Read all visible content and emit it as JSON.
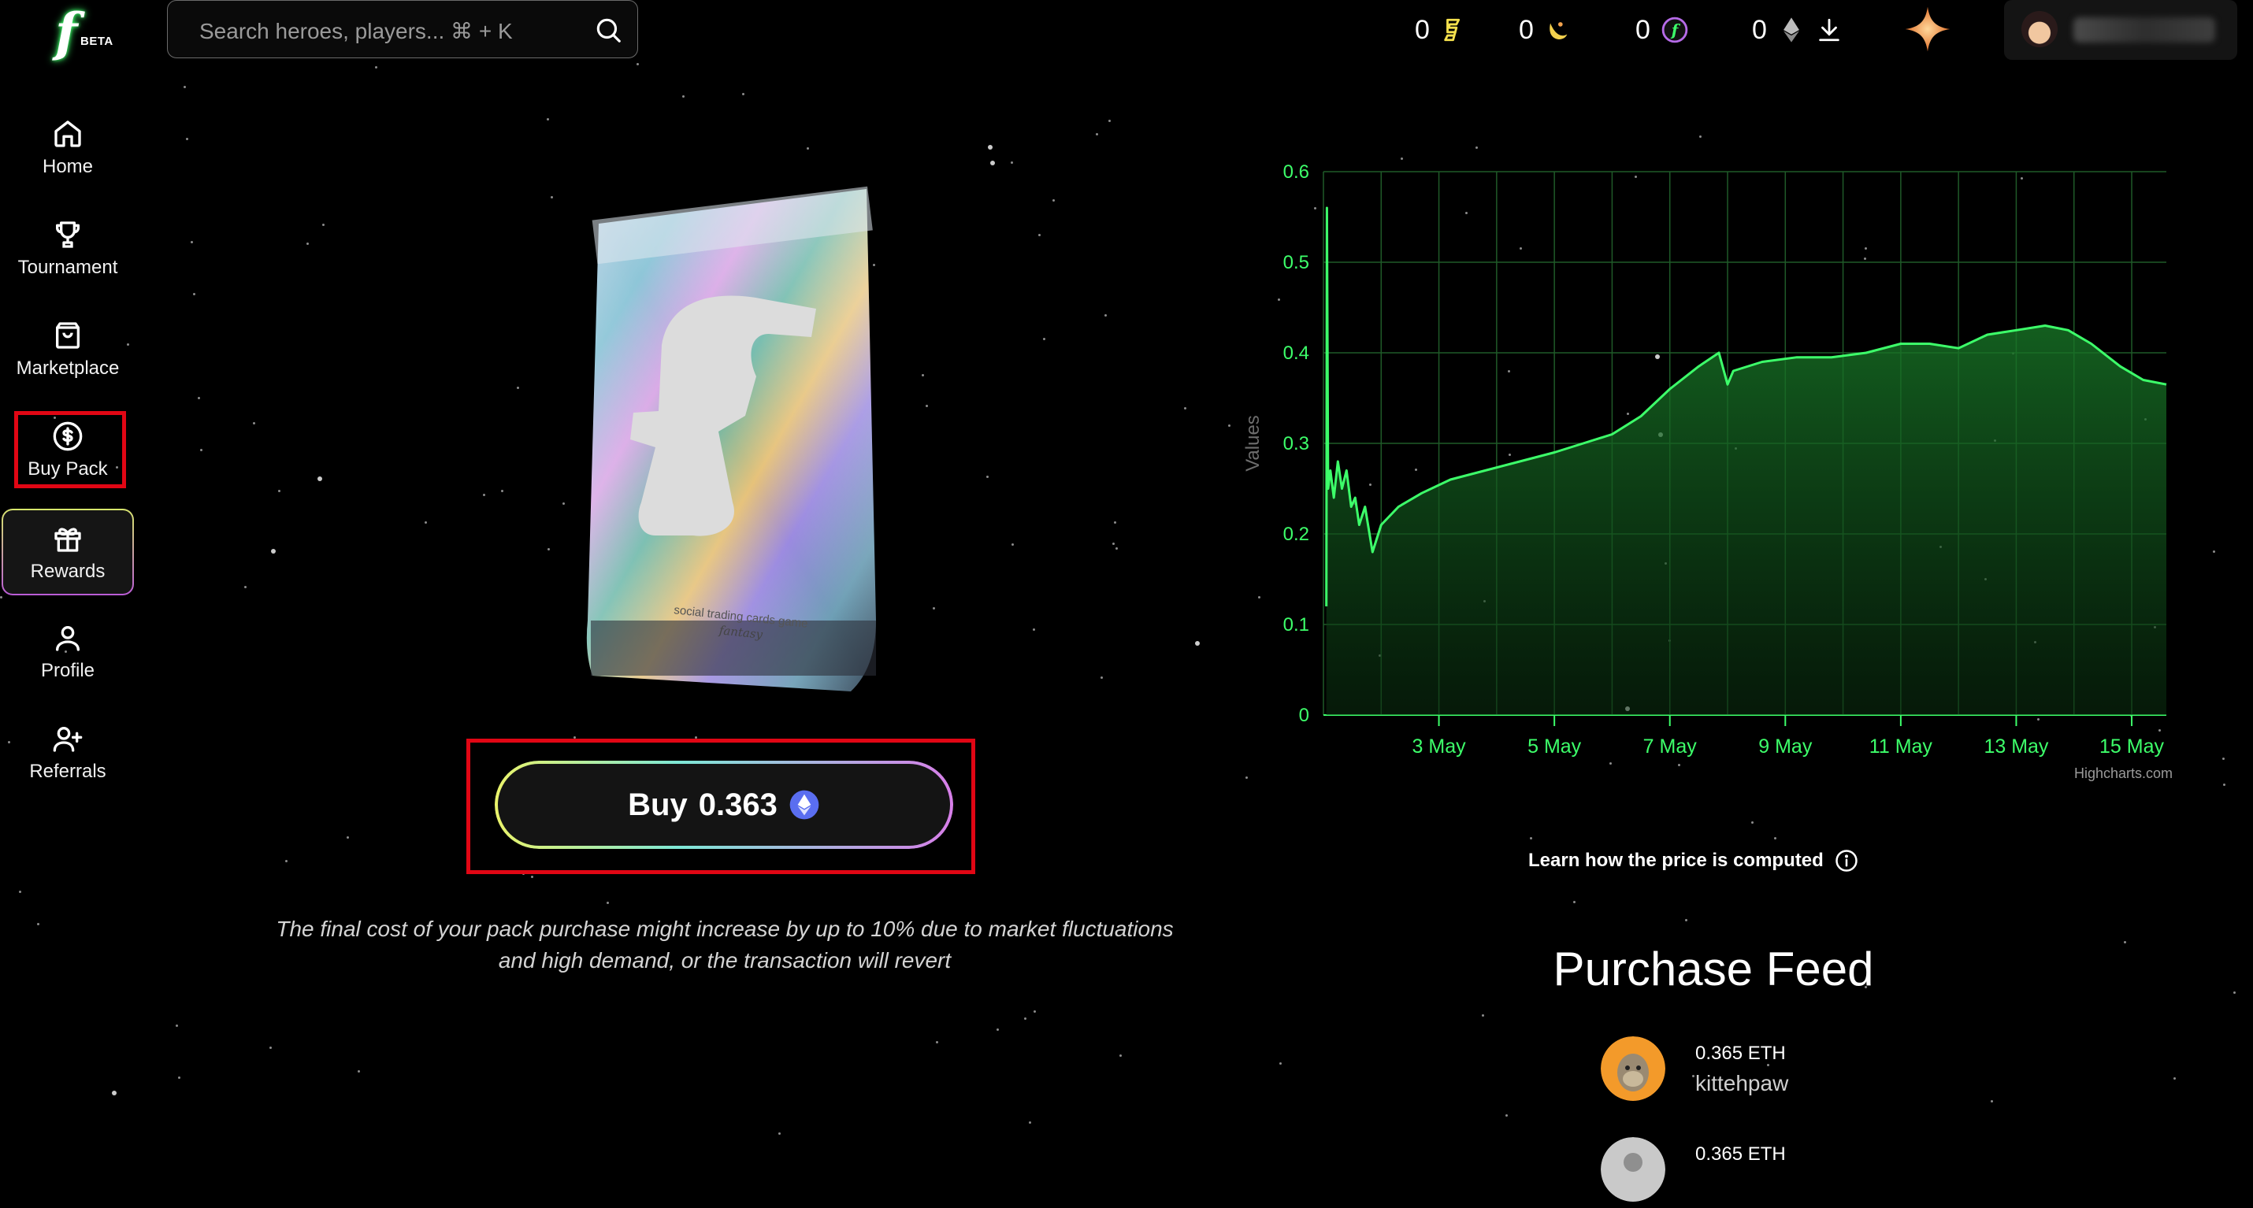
{
  "app": {
    "logo_glyph": "f",
    "logo_badge": "BETA"
  },
  "search": {
    "placeholder": "Search heroes, players... ⌘ + K"
  },
  "balances": [
    {
      "value": "0",
      "icon": "blast-b-icon",
      "color": "#f4e04d"
    },
    {
      "value": "0",
      "icon": "moon-icon",
      "color": "#f4d14d"
    },
    {
      "value": "0",
      "icon": "fantasy-f-coin-icon",
      "color": "#3dff6a"
    },
    {
      "value": "0",
      "icon": "ethereum-icon",
      "color": "#bdbdbd"
    }
  ],
  "sidebar": {
    "items": [
      {
        "label": "Home",
        "icon": "home-icon"
      },
      {
        "label": "Tournament",
        "icon": "trophy-icon"
      },
      {
        "label": "Marketplace",
        "icon": "shopping-bag-icon"
      },
      {
        "label": "Buy Pack",
        "icon": "dollar-circle-icon",
        "active": true
      },
      {
        "label": "Rewards",
        "icon": "gift-icon"
      },
      {
        "label": "Profile",
        "icon": "user-icon"
      },
      {
        "label": "Referrals",
        "icon": "user-plus-icon"
      }
    ]
  },
  "pack": {
    "caption_line1": "social trading cards game",
    "caption_line2": "fantasy"
  },
  "buy": {
    "label": "Buy",
    "price": "0.363",
    "currency_icon": "ethereum-badge-icon"
  },
  "disclaimer": {
    "line1": "The final cost of your pack purchase might increase by up to 10% due to market fluctuations",
    "line2": "and high demand, or the transaction will revert"
  },
  "chart_data": {
    "type": "area",
    "ylabel": "Values",
    "xlabel": "",
    "credits": "Highcharts.com",
    "ylim": [
      0,
      0.6
    ],
    "yticks": [
      "0",
      "0.1",
      "0.2",
      "0.3",
      "0.4",
      "0.5",
      "0.6"
    ],
    "x_ticks": [
      "3 May",
      "5 May",
      "7 May",
      "9 May",
      "11 May",
      "13 May",
      "15 May"
    ],
    "x_domain": [
      1.0,
      15.6
    ],
    "grid": true,
    "series": [
      {
        "color": "#3dff6a",
        "points": [
          [
            1.05,
            0.12
          ],
          [
            1.06,
            0.56
          ],
          [
            1.08,
            0.25
          ],
          [
            1.12,
            0.27
          ],
          [
            1.18,
            0.24
          ],
          [
            1.25,
            0.28
          ],
          [
            1.32,
            0.25
          ],
          [
            1.4,
            0.27
          ],
          [
            1.48,
            0.23
          ],
          [
            1.55,
            0.24
          ],
          [
            1.62,
            0.21
          ],
          [
            1.72,
            0.23
          ],
          [
            1.85,
            0.18
          ],
          [
            2.0,
            0.21
          ],
          [
            2.3,
            0.23
          ],
          [
            2.7,
            0.245
          ],
          [
            3.2,
            0.26
          ],
          [
            3.8,
            0.27
          ],
          [
            4.4,
            0.28
          ],
          [
            5.0,
            0.29
          ],
          [
            5.5,
            0.3
          ],
          [
            6.0,
            0.31
          ],
          [
            6.5,
            0.33
          ],
          [
            7.0,
            0.36
          ],
          [
            7.5,
            0.385
          ],
          [
            7.85,
            0.4
          ],
          [
            8.0,
            0.365
          ],
          [
            8.1,
            0.38
          ],
          [
            8.6,
            0.39
          ],
          [
            9.2,
            0.395
          ],
          [
            9.8,
            0.395
          ],
          [
            10.4,
            0.4
          ],
          [
            11.0,
            0.41
          ],
          [
            11.5,
            0.41
          ],
          [
            12.0,
            0.405
          ],
          [
            12.5,
            0.42
          ],
          [
            13.0,
            0.425
          ],
          [
            13.5,
            0.43
          ],
          [
            13.9,
            0.425
          ],
          [
            14.3,
            0.41
          ],
          [
            14.8,
            0.385
          ],
          [
            15.2,
            0.37
          ],
          [
            15.6,
            0.365
          ]
        ]
      }
    ]
  },
  "learn": {
    "text": "Learn how the price is computed",
    "icon": "info-icon"
  },
  "feed": {
    "title": "Purchase Feed",
    "items": [
      {
        "amount": "0.365 ETH",
        "user": "kittehpaw",
        "avatar_color": "#f39a2a"
      },
      {
        "amount": "0.365 ETH",
        "user": "",
        "avatar_color": "#c9c9c9"
      }
    ]
  }
}
